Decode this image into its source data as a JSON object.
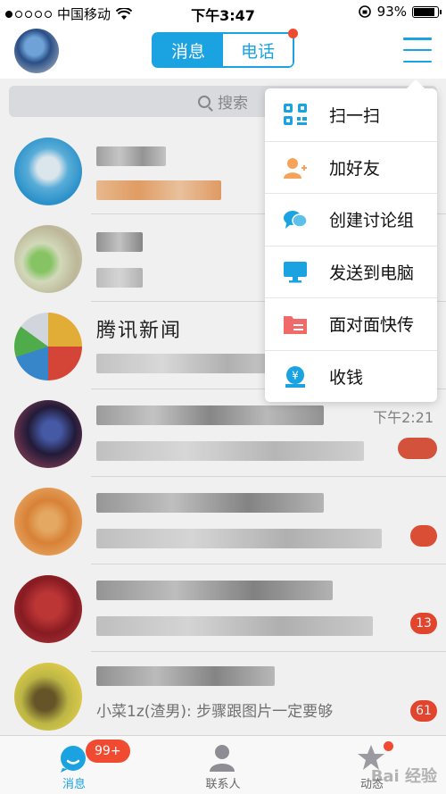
{
  "status_bar": {
    "carrier": "中国移动",
    "time": "下午3:47",
    "battery": "93%",
    "battery_level": 0.93
  },
  "header": {
    "tab_messages": "消息",
    "tab_calls": "电话"
  },
  "search": {
    "placeholder": "搜索"
  },
  "conversations": [
    {
      "title": "",
      "preview": "",
      "time": "",
      "badge": ""
    },
    {
      "title": "",
      "preview": "",
      "time": "",
      "badge": ""
    },
    {
      "title": "腾讯新闻",
      "preview": "",
      "time": "",
      "badge": ""
    },
    {
      "title": "",
      "preview": "",
      "time": "下午2:21",
      "badge": ""
    },
    {
      "title": "",
      "preview": "",
      "time": "",
      "badge": ""
    },
    {
      "title": "",
      "preview": "",
      "time": "",
      "badge": "13"
    },
    {
      "title": "",
      "preview": "小菜1z(渣男): 步骤跟图片一定要够",
      "time": "",
      "badge": "61"
    }
  ],
  "dropdown_menu": {
    "items": [
      {
        "label": "扫一扫",
        "icon": "scan-icon"
      },
      {
        "label": "加好友",
        "icon": "add-friend-icon"
      },
      {
        "label": "创建讨论组",
        "icon": "discussion-group-icon"
      },
      {
        "label": "发送到电脑",
        "icon": "send-to-computer-icon"
      },
      {
        "label": "面对面快传",
        "icon": "face-to-face-transfer-icon"
      },
      {
        "label": "收钱",
        "icon": "receive-money-icon"
      }
    ]
  },
  "tab_bar": {
    "tabs": [
      {
        "label": "消息",
        "badge": "99+",
        "active": true
      },
      {
        "label": "联系人"
      },
      {
        "label": "动态"
      }
    ]
  },
  "watermark": "Bai 经验",
  "colors": {
    "accent": "#1aa3e0",
    "badge": "#f04a31"
  }
}
